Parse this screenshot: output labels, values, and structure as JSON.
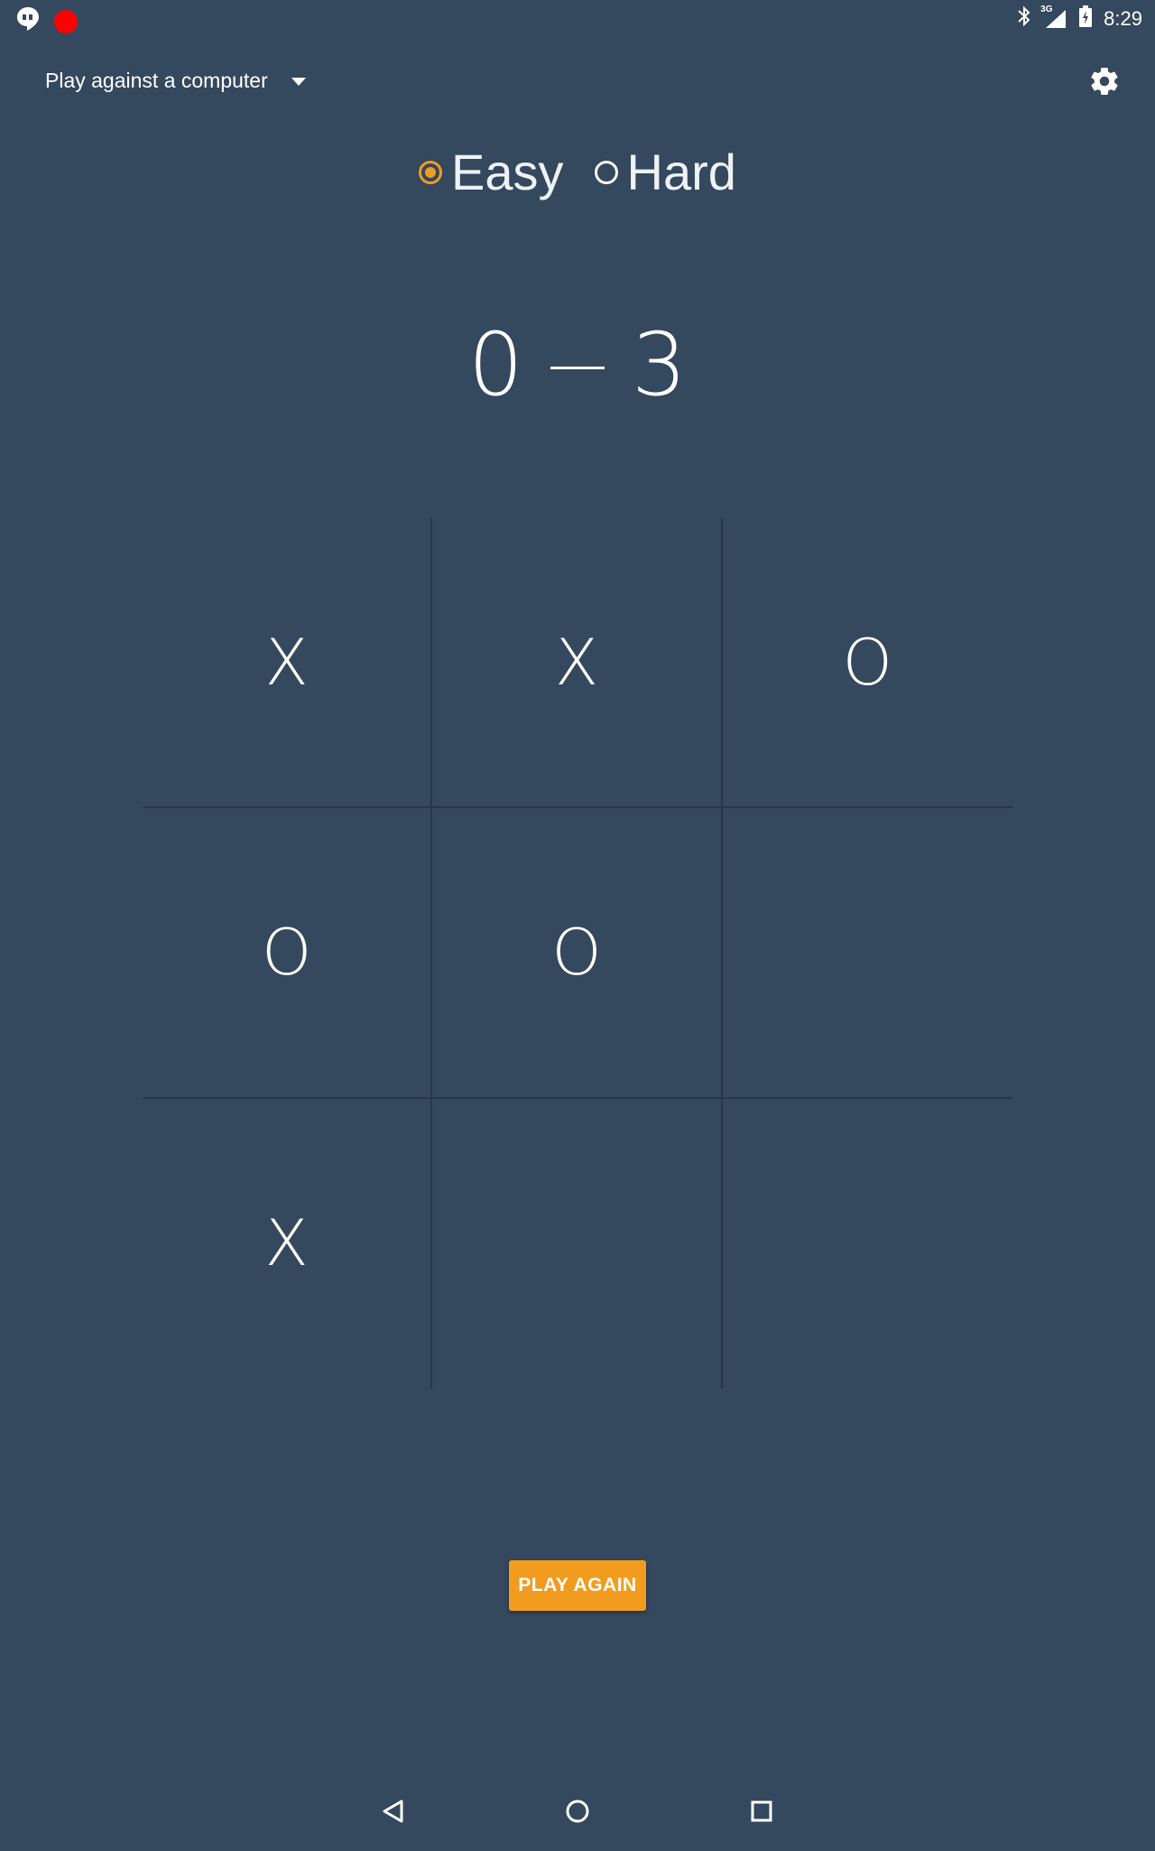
{
  "status_bar": {
    "time": "8:29",
    "network_label": "3G",
    "icons": [
      "hangouts-icon",
      "record-icon",
      "bluetooth-icon",
      "signal-icon",
      "battery-icon"
    ]
  },
  "app_bar": {
    "mode_label": "Play against a computer",
    "settings_icon": "gear-icon"
  },
  "difficulty": {
    "options": [
      {
        "label": "Easy",
        "checked": true
      },
      {
        "label": "Hard",
        "checked": false
      }
    ]
  },
  "score": {
    "left": "0",
    "right": "3"
  },
  "board": {
    "cells": [
      "X",
      "X",
      "O",
      "O",
      "O",
      "",
      "X",
      "",
      ""
    ]
  },
  "actions": {
    "play_again_label": "PLAY AGAIN"
  },
  "nav_bar": {
    "icons": [
      "back-icon",
      "home-icon",
      "recents-icon"
    ]
  },
  "colors": {
    "background": "#34485e",
    "accent": "#f29c1f",
    "grid_line": "#26384b"
  }
}
